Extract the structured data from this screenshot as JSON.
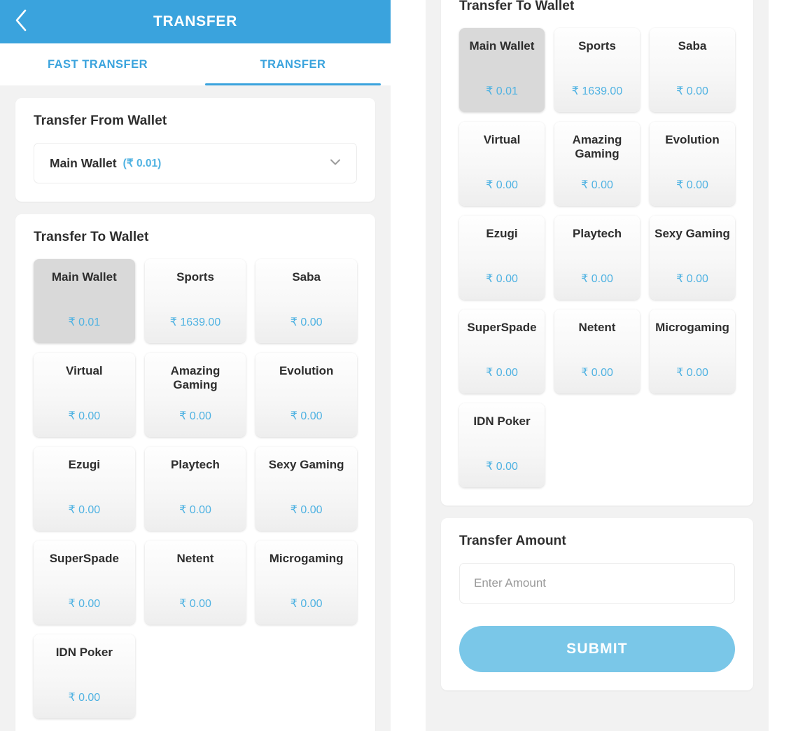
{
  "theme": {
    "accent": "#3aa3dd",
    "balance_color": "#4fb2e2",
    "submit_color": "#7ac7e8",
    "page_bg": "#f2f2f2",
    "selected_tile_bg": "#d9d9d9"
  },
  "appbar": {
    "title": "TRANSFER",
    "back_icon": "chevron-left-icon"
  },
  "tabs": [
    {
      "label": "FAST TRANSFER",
      "active": false
    },
    {
      "label": "TRANSFER",
      "active": true
    }
  ],
  "transfer_from": {
    "title": "Transfer From Wallet",
    "selected_wallet": "Main Wallet",
    "selected_balance": "(₹ 0.01)",
    "chevron_icon": "chevron-down-icon"
  },
  "transfer_to": {
    "title": "Transfer To Wallet",
    "wallets": [
      {
        "name": "Main Wallet",
        "balance": "₹ 0.01",
        "selected": true
      },
      {
        "name": "Sports",
        "balance": "₹ 1639.00",
        "selected": false
      },
      {
        "name": "Saba",
        "balance": "₹ 0.00",
        "selected": false
      },
      {
        "name": "Virtual",
        "balance": "₹ 0.00",
        "selected": false
      },
      {
        "name": "Amazing Gaming",
        "balance": "₹ 0.00",
        "selected": false
      },
      {
        "name": "Evolution",
        "balance": "₹ 0.00",
        "selected": false
      },
      {
        "name": "Ezugi",
        "balance": "₹ 0.00",
        "selected": false
      },
      {
        "name": "Playtech",
        "balance": "₹ 0.00",
        "selected": false
      },
      {
        "name": "Sexy Gaming",
        "balance": "₹ 0.00",
        "selected": false
      },
      {
        "name": "SuperSpade",
        "balance": "₹ 0.00",
        "selected": false
      },
      {
        "name": "Netent",
        "balance": "₹ 0.00",
        "selected": false
      },
      {
        "name": "Microgaming",
        "balance": "₹ 0.00",
        "selected": false
      },
      {
        "name": "IDN Poker",
        "balance": "₹ 0.00",
        "selected": false
      }
    ]
  },
  "transfer_amount": {
    "title": "Transfer Amount",
    "value": "",
    "placeholder": "Enter Amount"
  },
  "submit": {
    "label": "SUBMIT"
  }
}
